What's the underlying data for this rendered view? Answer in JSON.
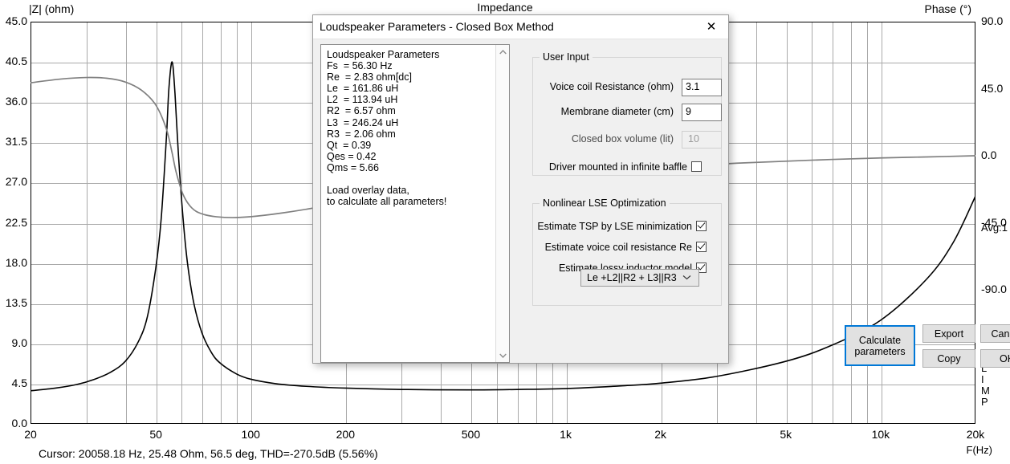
{
  "chart_data": {
    "type": "line",
    "title": "Impedance",
    "xlabel": "F(Hz)",
    "ylabel_left": "|Z| (ohm)",
    "ylabel_right": "Phase (°)",
    "xscale": "log",
    "xlim": [
      20,
      20000
    ],
    "ylim_left": [
      0.0,
      45.0
    ],
    "ylim_right": [
      -180.0,
      90.0
    ],
    "grid": true,
    "xticks": [
      "20",
      "50",
      "100",
      "200",
      "500",
      "1k",
      "2k",
      "5k",
      "10k",
      "20k"
    ],
    "xtick_values": [
      20,
      50,
      100,
      200,
      500,
      1000,
      2000,
      5000,
      10000,
      20000
    ],
    "yticks_left": [
      "45.0",
      "40.5",
      "36.0",
      "31.5",
      "27.0",
      "22.5",
      "18.0",
      "13.5",
      "9.0",
      "4.5",
      "0.0"
    ],
    "ytick_left_values": [
      45.0,
      40.5,
      36.0,
      31.5,
      27.0,
      22.5,
      18.0,
      13.5,
      9.0,
      4.5,
      0.0
    ],
    "yticks_right": [
      "90.0",
      "45.0",
      "0.0",
      "-45.0",
      "-90.0"
    ],
    "ytick_right_values": [
      90.0,
      45.0,
      0.0,
      -45.0,
      -90.0
    ],
    "annotations": [
      "Avg:1",
      "LIMP"
    ],
    "series": [
      {
        "name": "Impedance magnitude |Z| (ohm)",
        "color": "#000000",
        "axis": "left",
        "x": [
          20,
          24,
          28,
          32,
          36,
          40,
          44,
          47,
          50,
          52,
          54,
          55,
          56.3,
          57.5,
          59,
          61,
          63,
          66,
          70,
          75,
          80,
          90,
          100,
          120,
          150,
          200,
          300,
          500,
          700,
          1000,
          1500,
          2000,
          3000,
          5000,
          7000,
          10000,
          14000,
          17000,
          20000
        ],
        "y": [
          3.7,
          4.0,
          4.4,
          5.0,
          5.8,
          7.0,
          9.2,
          12.0,
          17.5,
          23.0,
          32.0,
          37.5,
          40.5,
          37.0,
          30.0,
          23.0,
          18.0,
          13.5,
          10.2,
          8.0,
          6.8,
          5.6,
          5.0,
          4.5,
          4.2,
          4.0,
          3.85,
          3.8,
          3.85,
          3.95,
          4.25,
          4.55,
          5.3,
          7.0,
          8.8,
          11.6,
          16.2,
          20.3,
          25.48
        ]
      },
      {
        "name": "Phase (°)",
        "color": "#808080",
        "axis": "right",
        "x": [
          20,
          25,
          30,
          35,
          40,
          45,
          50,
          54,
          56.3,
          58,
          61,
          65,
          70,
          78,
          90,
          105,
          130,
          170,
          230,
          330,
          500,
          800,
          1200,
          2000,
          3500,
          6000,
          10000,
          14000,
          20000
        ],
        "y": [
          49.0,
          51.5,
          52.5,
          52.0,
          49.5,
          44.0,
          34.0,
          18.0,
          2.0,
          -11.0,
          -26.0,
          -35.0,
          -39.0,
          -41.0,
          -41.5,
          -40.5,
          -38.0,
          -34.0,
          -29.0,
          -24.0,
          -19.0,
          -14.5,
          -11.5,
          -8.0,
          -5.0,
          -3.0,
          -1.5,
          -0.8,
          0.0
        ]
      }
    ]
  },
  "chart": {
    "title": "Impedance",
    "y_left_title": "|Z| (ohm)",
    "y_right_title": "Phase (°)",
    "x_title": "F(Hz)",
    "avg_label": "Avg:1",
    "limp_label": "LIMP",
    "cursor_text": "Cursor: 20058.18 Hz, 25.48 Ohm, 56.5 deg, THD=-270.5dB (5.56%)"
  },
  "dialog": {
    "title": "Loudspeaker Parameters - Closed Box Method",
    "close_icon": "✕",
    "parameters_text": "Loudspeaker Parameters\nFs  = 56.30 Hz\nRe  = 2.83 ohm[dc]\nLe  = 161.86 uH\nL2  = 113.94 uH\nR2  = 6.57 ohm\nL3  = 246.24 uH\nR3  = 2.06 ohm\nQt  = 0.39\nQes = 0.42\nQms = 5.66\n\nLoad overlay data,\nto calculate all parameters!",
    "parameters": {
      "heading": "Loudspeaker Parameters",
      "Fs": "56.30 Hz",
      "Re": "2.83 ohm[dc]",
      "Le": "161.86 uH",
      "L2": "113.94 uH",
      "R2": "6.57 ohm",
      "L3": "246.24 uH",
      "R3": "2.06 ohm",
      "Qt": "0.39",
      "Qes": "0.42",
      "Qms": "5.66",
      "note": "Load overlay data, to calculate all parameters!"
    },
    "scrollbar": {
      "up_icon": "▲",
      "down_icon": "▼"
    },
    "user_input": {
      "legend": "User Input",
      "voice_coil_resistance_label": "Voice coil Resistance (ohm)",
      "voice_coil_resistance_value": "3.1",
      "membrane_diameter_label": "Membrane diameter (cm)",
      "membrane_diameter_value": "9",
      "closed_box_volume_label": "Closed box volume (lit)",
      "closed_box_volume_value": "10",
      "infinite_baffle_label": "Driver mounted in infinite baffle",
      "infinite_baffle_checked": false
    },
    "lse": {
      "legend": "Nonlinear LSE Optimization",
      "estimate_tsp_label": "Estimate TSP by LSE minimization",
      "estimate_tsp_checked": true,
      "estimate_re_label": "Estimate voice coil resistance Re",
      "estimate_re_checked": true,
      "estimate_inductor_label": "Estimate lossy inductor model",
      "estimate_inductor_checked": true,
      "model_selected": "Le +L2||R2 + L3||R3",
      "model_arrow": "⌄"
    },
    "buttons": {
      "calculate": "Calculate\nparameters",
      "calculate_line1": "Calculate",
      "calculate_line2": "parameters",
      "export": "Export",
      "cancel": "Cancel",
      "copy": "Copy",
      "ok": "OK"
    }
  },
  "colors": {
    "accent": "#0078d7",
    "impedance_curve": "#000000",
    "phase_curve": "#808080",
    "grid": "#a9a9a9",
    "dialog_bg": "#f0f0f0"
  }
}
